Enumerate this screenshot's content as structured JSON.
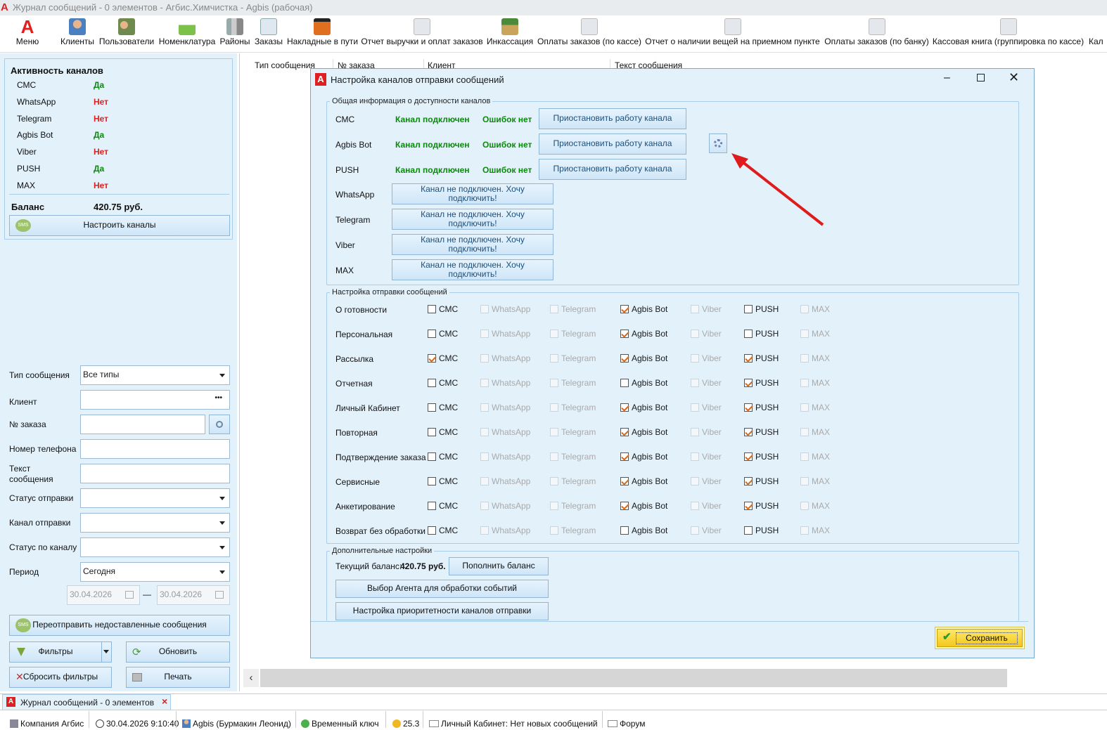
{
  "window": {
    "title": "Журнал сообщений - 0 элементов - Агбис.Химчистка - Agbis (рабочая)"
  },
  "toolbar": {
    "items": [
      "Меню",
      "Клиенты",
      "Пользователи",
      "Номенклатура",
      "Районы",
      "Заказы",
      "Накладные в пути",
      "Отчет выручки и оплат заказов",
      "Инкассация",
      "Оплаты заказов (по кассе)",
      "Отчет о наличии вещей на приемном пункте",
      "Оплаты заказов (по банку)",
      "Кассовая книга (группировка по кассе)",
      "Кал"
    ]
  },
  "activity": {
    "title": "Активность каналов",
    "channels": [
      {
        "name": "СМС",
        "status": "Да"
      },
      {
        "name": "WhatsApp",
        "status": "Нет"
      },
      {
        "name": "Telegram",
        "status": "Нет"
      },
      {
        "name": "Agbis Bot",
        "status": "Да"
      },
      {
        "name": "Viber",
        "status": "Нет"
      },
      {
        "name": "PUSH",
        "status": "Да"
      },
      {
        "name": "MAX",
        "status": "Нет"
      }
    ],
    "balance_label": "Баланс",
    "balance_value": "420.75 руб.",
    "configure_button": "Настроить каналы"
  },
  "filters": {
    "type_label": "Тип сообщения",
    "type_value": "Все типы",
    "client_label": "Клиент",
    "client_dots": "•••",
    "order_label": "№ заказа",
    "phone_label": "Номер телефона",
    "text_label_1": "Текст",
    "text_label_2": "сообщения",
    "send_status_label": "Статус отправки",
    "channel_label": "Канал отправки",
    "channel_status_label": "Статус по каналу",
    "period_label": "Период",
    "period_value": "Сегодня",
    "date_from": "30.04.2026",
    "date_dash": "—",
    "date_to": "30.04.2026",
    "resend_button": "Переотправить недоставленные сообщения",
    "filters_button": "Фильтры",
    "refresh_button": "Обновить",
    "reset_button": "Сбросить фильтры",
    "print_button": "Печать"
  },
  "grid": {
    "columns": [
      "Тип сообщения",
      "№ заказа",
      "Клиент",
      "Текст сообщения"
    ]
  },
  "dialog": {
    "title": "Настройка каналов отправки сообщений",
    "group1_title": "Общая информация о доступности каналов",
    "connected": [
      {
        "name": "СМС",
        "state": "Канал подключен",
        "errors": "Ошибок нет",
        "button": "Приостановить работу канала"
      },
      {
        "name": "Agbis Bot",
        "state": "Канал подключен",
        "errors": "Ошибок нет",
        "button": "Приостановить работу канала"
      },
      {
        "name": "PUSH",
        "state": "Канал подключен",
        "errors": "Ошибок нет",
        "button": "Приостановить работу канала"
      }
    ],
    "not_connected": [
      {
        "name": "WhatsApp",
        "button": "Канал не подключен. Хочу подключить!"
      },
      {
        "name": "Telegram",
        "button": "Канал не подключен. Хочу подключить!"
      },
      {
        "name": "Viber",
        "button": "Канал не подключен. Хочу подключить!"
      },
      {
        "name": "MAX",
        "button": "Канал не подключен. Хочу подключить!"
      }
    ],
    "group2_title": "Настройка отправки сообщений",
    "channel_columns": [
      "СМС",
      "WhatsApp",
      "Telegram",
      "Agbis Bot",
      "Viber",
      "PUSH",
      "MAX"
    ],
    "rows": [
      {
        "name": "О готовности",
        "checks": [
          false,
          false,
          false,
          true,
          false,
          false,
          false
        ]
      },
      {
        "name": "Персональная",
        "checks": [
          false,
          false,
          false,
          true,
          false,
          false,
          false
        ]
      },
      {
        "name": "Рассылка",
        "checks": [
          true,
          false,
          false,
          true,
          false,
          true,
          false
        ]
      },
      {
        "name": "Отчетная",
        "checks": [
          false,
          false,
          false,
          false,
          false,
          true,
          false
        ]
      },
      {
        "name": "Личный Кабинет",
        "checks": [
          false,
          false,
          false,
          true,
          false,
          true,
          false
        ]
      },
      {
        "name": "Повторная",
        "checks": [
          false,
          false,
          false,
          true,
          false,
          true,
          false
        ]
      },
      {
        "name": "Подтверждение заказа",
        "checks": [
          false,
          false,
          false,
          true,
          false,
          true,
          false
        ]
      },
      {
        "name": "Сервисные",
        "checks": [
          false,
          false,
          false,
          true,
          false,
          true,
          false
        ]
      },
      {
        "name": "Анкетирование",
        "checks": [
          false,
          false,
          false,
          true,
          false,
          true,
          false
        ]
      },
      {
        "name": "Возврат без обработки",
        "checks": [
          false,
          false,
          false,
          false,
          false,
          false,
          false
        ]
      }
    ],
    "disabled_columns": [
      1,
      2,
      4,
      6
    ],
    "group3_title": "Дополнительные настройки",
    "balance_label": "Текущий баланс:",
    "balance_value": "420.75 руб.",
    "topup_button": "Пополнить баланс",
    "agent_button": "Выбор Агента для обработки событий",
    "priority_button": "Настройка приоритетности каналов отправки",
    "save_button": "Сохранить"
  },
  "tabs": {
    "active": "Журнал сообщений - 0 элементов",
    "close": "×"
  },
  "status": {
    "company": "Компания Агбис",
    "datetime": "30.04.2026 9:10:40",
    "user": "Agbis (Бурмакин Леонид)",
    "key": "Временный ключ",
    "version": "25.3",
    "cabinet": "Личный Кабинет: Нет новых сообщений",
    "forum": "Форум"
  },
  "colors": {
    "accent_blue": "#1d4f7a",
    "green": "#0a8a0a",
    "red": "#e02020",
    "arrow": "#e01b1b"
  }
}
